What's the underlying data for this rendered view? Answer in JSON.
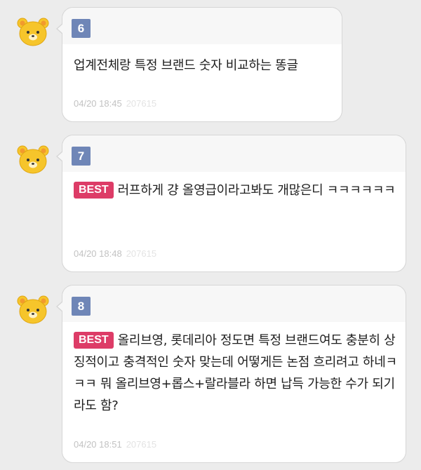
{
  "comments": [
    {
      "number": "6",
      "best": false,
      "text": "업계전체랑 특정 브랜드 숫자 비교하는 똥글",
      "datetime": "04/20 18:45",
      "views": "207615"
    },
    {
      "number": "7",
      "best": true,
      "best_label": "BEST",
      "text": "러프하게 걍 올영급이라고봐도 개많은디 ㅋㅋㅋㅋㅋㅋ",
      "datetime": "04/20 18:48",
      "views": "207615"
    },
    {
      "number": "8",
      "best": true,
      "best_label": "BEST",
      "text": "올리브영, 롯데리아 정도면 특정 브랜드여도 충분히 상징적이고 충격적인 숫자 맞는데 어떻게든 논점 흐리려고 하네ㅋㅋㅋ 뭐 올리브영+롭스+랄라블라 하면 납득 가능한 수가 되기라도 함?",
      "datetime": "04/20 18:51",
      "views": "207615"
    }
  ],
  "colors": {
    "badge": "#6f86b7",
    "best": "#dd3c67",
    "avatar": "#f6c52b"
  },
  "icons": {
    "avatar": "bear-face-icon"
  }
}
